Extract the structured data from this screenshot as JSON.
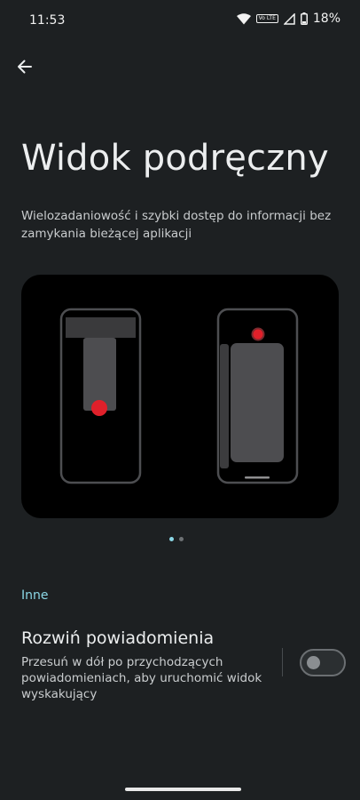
{
  "status_bar": {
    "time": "11:53",
    "volte_label": "Vo LTE",
    "battery": "18%",
    "icons": [
      "wifi-icon",
      "volte-icon",
      "signal-icon",
      "battery-icon"
    ]
  },
  "header": {
    "back_icon": "arrow-left-icon"
  },
  "page": {
    "title": "Widok podręczny",
    "description": "Wielozadaniowość i szybki dostęp do informacji bez zamykania bieżącej aplikacji"
  },
  "carousel": {
    "pages": 2,
    "active_index": 0
  },
  "section": {
    "label": "Inne"
  },
  "setting": {
    "title": "Rozwiń powiadomienia",
    "subtitle": "Przesuń w dół po przychodzących powiadomieniach, aby uruchomić widok wyskakujący",
    "enabled": false
  },
  "colors": {
    "background": "#1d2022",
    "accent": "#8bd7e6",
    "illustration_red": "#e0202a"
  }
}
